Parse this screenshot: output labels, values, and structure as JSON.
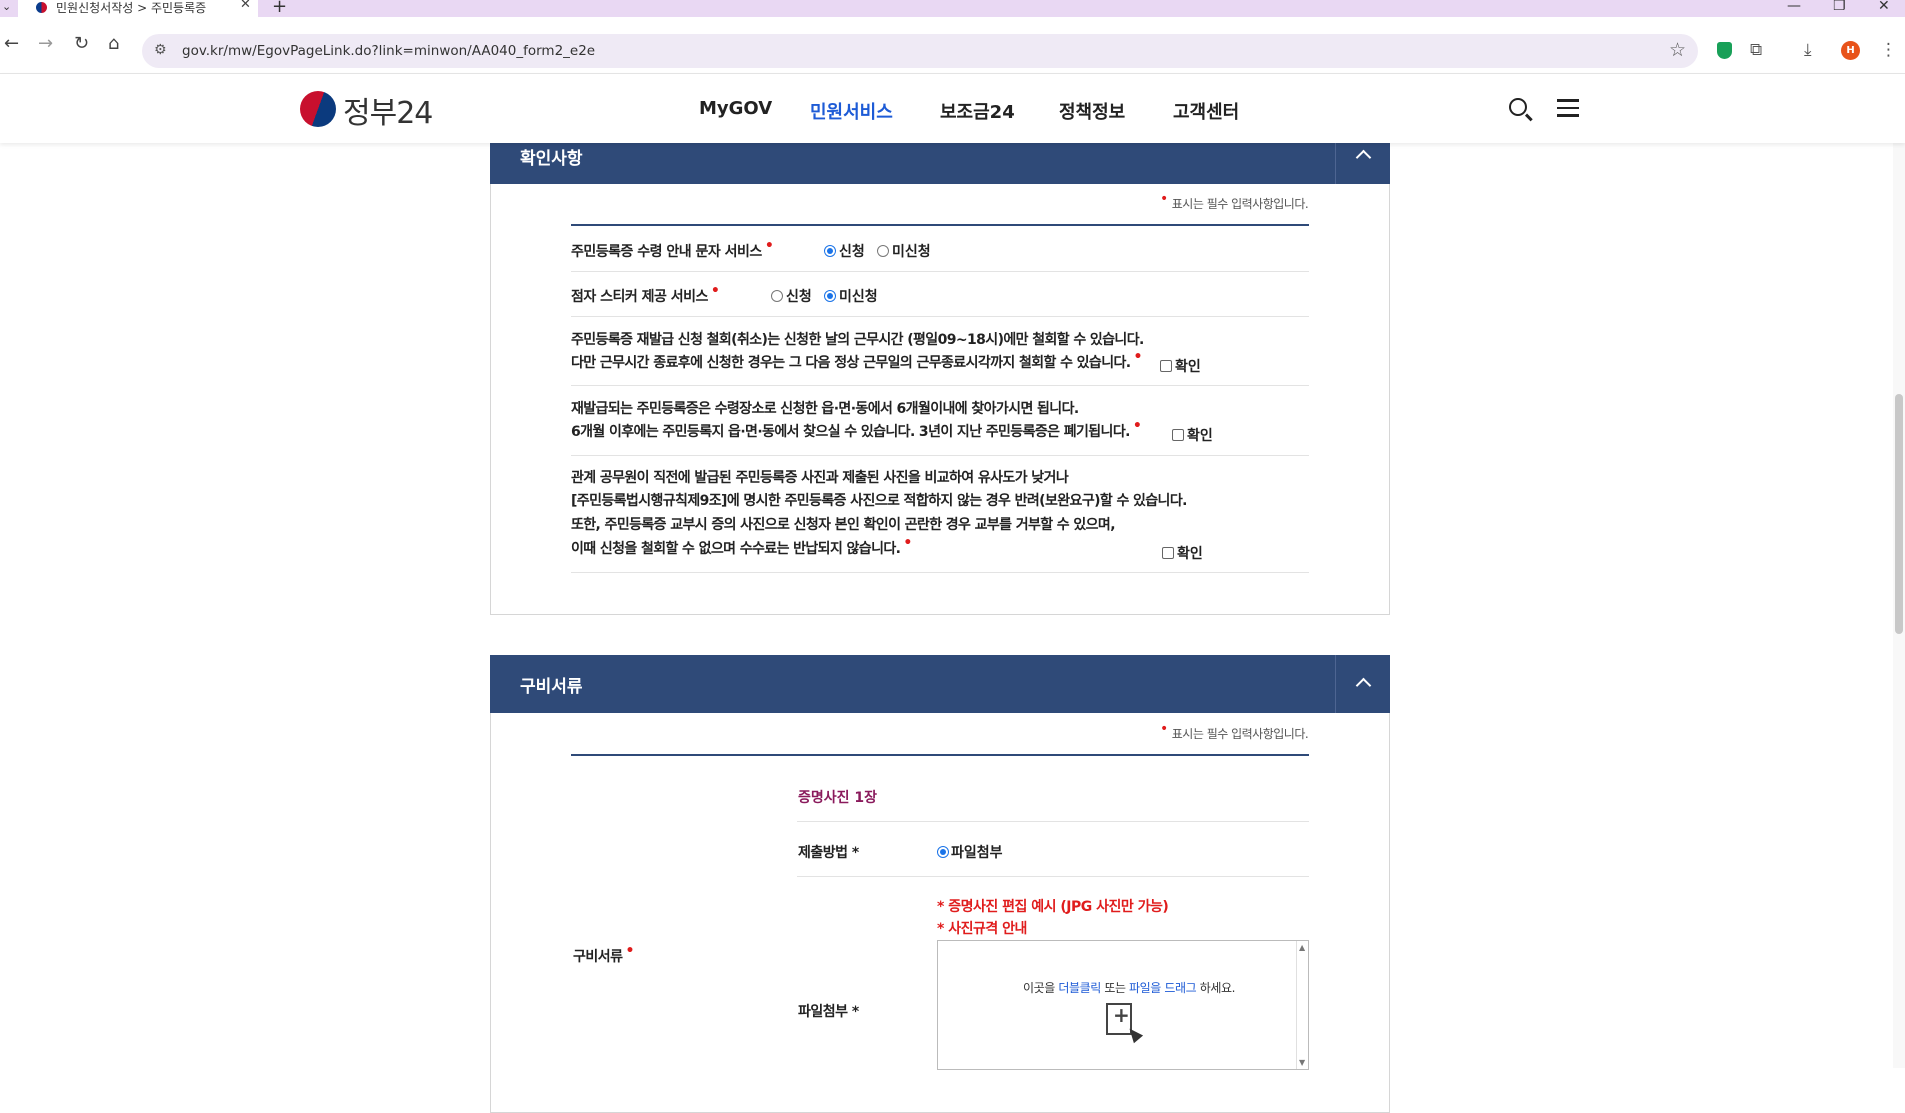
{
  "browser": {
    "tab_title": "민원신청서작성 > 주민등록증",
    "url": "gov.kr/mw/EgovPageLink.do?link=minwon/AA040_form2_e2e",
    "profile_initial": "H"
  },
  "site": {
    "logo_text": "정부24",
    "nav": [
      {
        "label": "MyGOV"
      },
      {
        "label": "민원서비스"
      },
      {
        "label": "보조금24"
      },
      {
        "label": "정책정보"
      },
      {
        "label": "고객센터"
      }
    ],
    "active_nav": "민원서비스"
  },
  "confirm_section": {
    "title": "확인사항",
    "required_note": "표시는 필수 입력사항입니다.",
    "sms_label": "주민등록증 수령 안내 문자 서비스",
    "sms_options": [
      "신청",
      "미신청"
    ],
    "sms_selected": "신청",
    "braille_label": "점자 스티커 제공 서비스",
    "braille_options": [
      "신청",
      "미신청"
    ],
    "braille_selected": "미신청",
    "notice1": [
      "주민등록증 재발급 신청 철회(취소)는 신청한 날의 근무시간 (평일09~18시)에만 철회할 수 있습니다.",
      "다만 근무시간 종료후에 신청한 경우는 그 다음 정상 근무일의 근무종료시각까지 철회할 수 있습니다."
    ],
    "notice2": [
      "재발급되는 주민등록증은 수령장소로 신청한 읍·면·동에서 6개월이내에 찾아가시면 됩니다.",
      "6개월 이후에는 주민등록지 읍·면·동에서 찾으실 수 있습니다. 3년이 지난 주민등록증은 폐기됩니다."
    ],
    "notice3": [
      "관계 공무원이 직전에 발급된 주민등록증 사진과 제출된 사진을 비교하여 유사도가 낮거나",
      "[주민등록법시행규칙제9조]에 명시한 주민등록증 사진으로 적합하지 않는 경우 반려(보완요구)할 수 있습니다.",
      "또한, 주민등록증 교부시 증의 사진으로 신청자 본인 확인이 곤란한 경우 교부를 거부할 수 있으며,",
      "이때 신청을 철회할 수 없으며 수수료는 반납되지 않습니다."
    ],
    "confirm_label": "확인"
  },
  "docs_section": {
    "title": "구비서류",
    "required_note": "표시는 필수 입력사항입니다.",
    "row_label": "구비서류",
    "doc_name": "증명사진 1장",
    "method_label": "제출방법 *",
    "method_option": "파일첨부",
    "attach_label": "파일첨부 *",
    "photo_example_link": "* 증명사진 편집 예시 (JPG 사진만 가능)",
    "photo_rule_link": "* 사진규격 안내",
    "upload_prefix": "이곳을 ",
    "upload_dblclick": "더블클릭",
    "upload_or": " 또는 ",
    "upload_drag": "파일을 드래그",
    "upload_suffix": " 하세요."
  }
}
